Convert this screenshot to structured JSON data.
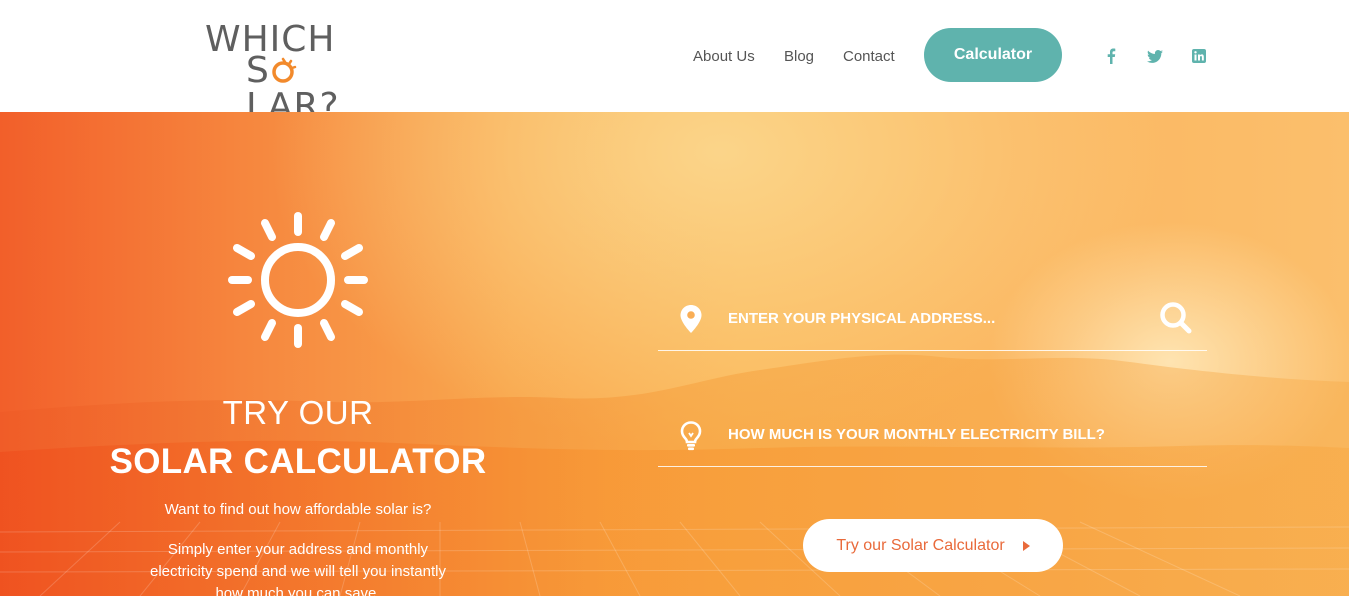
{
  "header": {
    "logo": {
      "line1": "WHICH",
      "line2": "S",
      "line2_rest": "LAR?"
    },
    "nav": [
      {
        "label": "About Us"
      },
      {
        "label": "Blog"
      },
      {
        "label": "Contact"
      }
    ],
    "cta_label": "Calculator",
    "social": [
      {
        "icon": "facebook-icon"
      },
      {
        "icon": "twitter-icon"
      },
      {
        "icon": "linkedin-icon"
      }
    ],
    "colors": {
      "accent": "#5fb3ad",
      "logo_text": "#5f5f5f",
      "logo_o": "#f28a2c"
    }
  },
  "hero": {
    "title_line1": "TRY OUR",
    "title_line2": "SOLAR CALCULATOR",
    "subtitle": "Want to find out how affordable solar is?",
    "description": "Simply enter your address and monthly electricity spend and we will tell you instantly how much you can save.",
    "address_placeholder": "ENTER YOUR PHYSICAL ADDRESS...",
    "bill_placeholder": "HOW MUCH IS YOUR MONTHLY ELECTRICITY BILL?",
    "button_label": "Try our Solar Calculator",
    "colors": {
      "gradient_left": "#f25f2a",
      "gradient_right": "#fbbf6c",
      "button_text": "#e96a3b"
    }
  }
}
